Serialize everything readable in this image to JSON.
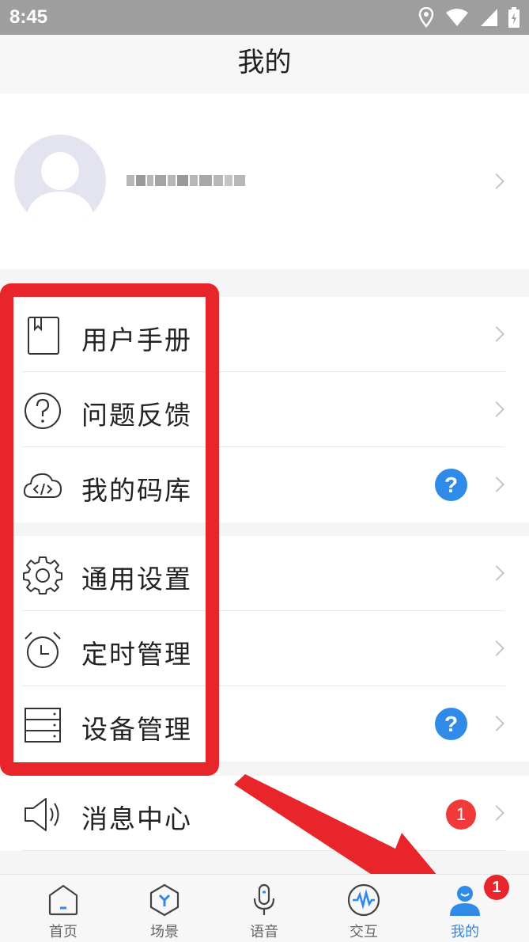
{
  "status_bar": {
    "time": "8:45",
    "icons": [
      "location-icon",
      "wifi-icon",
      "signal-icon",
      "battery-icon"
    ]
  },
  "header": {
    "title": "我的"
  },
  "menu": {
    "group1": [
      {
        "label": "用户手册",
        "icon": "book-icon"
      },
      {
        "label": "问题反馈",
        "icon": "question-circle-icon"
      },
      {
        "label": "我的码库",
        "icon": "cloud-code-icon",
        "badge": "?"
      }
    ],
    "group2": [
      {
        "label": "通用设置",
        "icon": "gear-icon"
      },
      {
        "label": "定时管理",
        "icon": "alarm-clock-icon"
      },
      {
        "label": "设备管理",
        "icon": "server-icon",
        "badge": "?"
      }
    ],
    "group3": [
      {
        "label": "消息中心",
        "icon": "speaker-icon",
        "badge": "1"
      }
    ]
  },
  "tabs": [
    {
      "label": "首页",
      "icon": "home-icon"
    },
    {
      "label": "场景",
      "icon": "scene-hexagon-icon"
    },
    {
      "label": "语音",
      "icon": "microphone-icon"
    },
    {
      "label": "交互",
      "icon": "waveform-icon"
    },
    {
      "label": "我的",
      "icon": "user-icon",
      "active": true,
      "badge": "1"
    }
  ],
  "colors": {
    "accent": "#2f8ae8",
    "highlight": "#e8252b",
    "badge_red": "#f03a3a"
  }
}
